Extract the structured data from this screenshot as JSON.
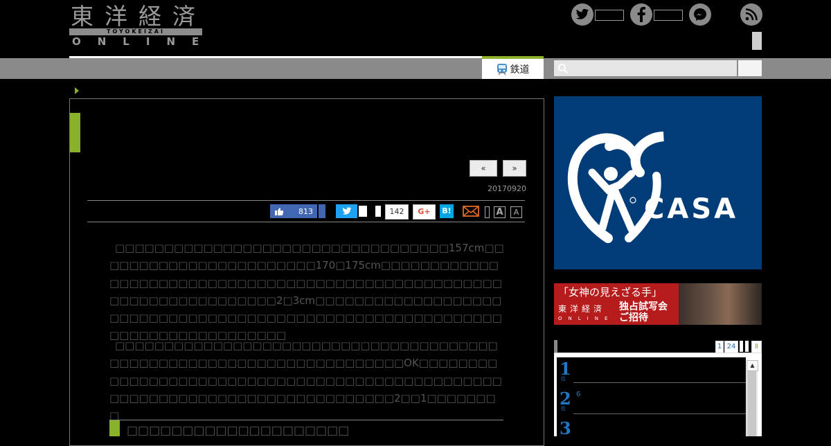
{
  "header": {
    "logo_kanji": "東洋経済",
    "logo_sub": "TOYOKEIZAI",
    "logo_online": "ONLINE",
    "sns_icons": [
      "twitter-icon",
      "facebook-icon",
      "messenger-icon",
      "rss-icon"
    ]
  },
  "nav": {
    "tab_label": "鉄道",
    "search_placeholder": ""
  },
  "article": {
    "prev_label": "«",
    "next_label": "»",
    "date": "20170920",
    "share": {
      "like_count": "813",
      "hatena_count": "142",
      "gplus_label": "G+",
      "hatena_label": "B!",
      "font_large": "A",
      "font_small": "A"
    },
    "paragraph1": "□□□□□□□□□□□□□□□□□□□□□□□□□□□□□□□□□□157cm□□□□□□□□□□□□□□□□□□□□□□□170□175cm□□□□□□□□□□□□□□□□□□□□□□□□□□□□□□□□□□□□□□□□□□□□□□□□□□□□□□□□□□□□□□□□□□□□□2□3cm□□□□□□□□□□□□□□□□□□□□□□□□□□□□□□□□□□□□□□□□□□□□□□□□□□□□□□□□□□□□□□□□□□□□□□□□□□□□□",
    "paragraph2": "□□□□□□□□□□□□□□□□□□□□□□□□□□□□□□□□□□□□□□□□□□□□□□□□□□□□□□□□□□□□□□□□□□□□□OK□□□□□□□□□□□□□□□□□□□□□□□□□□□□□□□□□□□□□□□□□□□□□□□□□□□□□□□□□□□□□□□□□□□□□□□□□□□□□2□□1□□□□□□□□",
    "subheading": "□□□□□□□□□□□□□□□□□□□□"
  },
  "sidebar": {
    "casa_text": "CASA",
    "movie_quote": "「女神の見えざる手」",
    "movie_logo": "東洋経済",
    "movie_logo_online": "ONLINE",
    "movie_line1": "独占試写会",
    "movie_line2": "ご招待",
    "ranking_tabs": [
      "1",
      "24"
    ],
    "ranking_nums": [
      "1",
      "2",
      "3"
    ],
    "ranking_extra": "6",
    "scroll_up": "▲"
  },
  "colors": {
    "accent": "#8ab12a",
    "facebook": "#4267b2",
    "twitter": "#1da1f2",
    "casa_bg": "#003c78",
    "rank_blue": "#1e78c8"
  }
}
